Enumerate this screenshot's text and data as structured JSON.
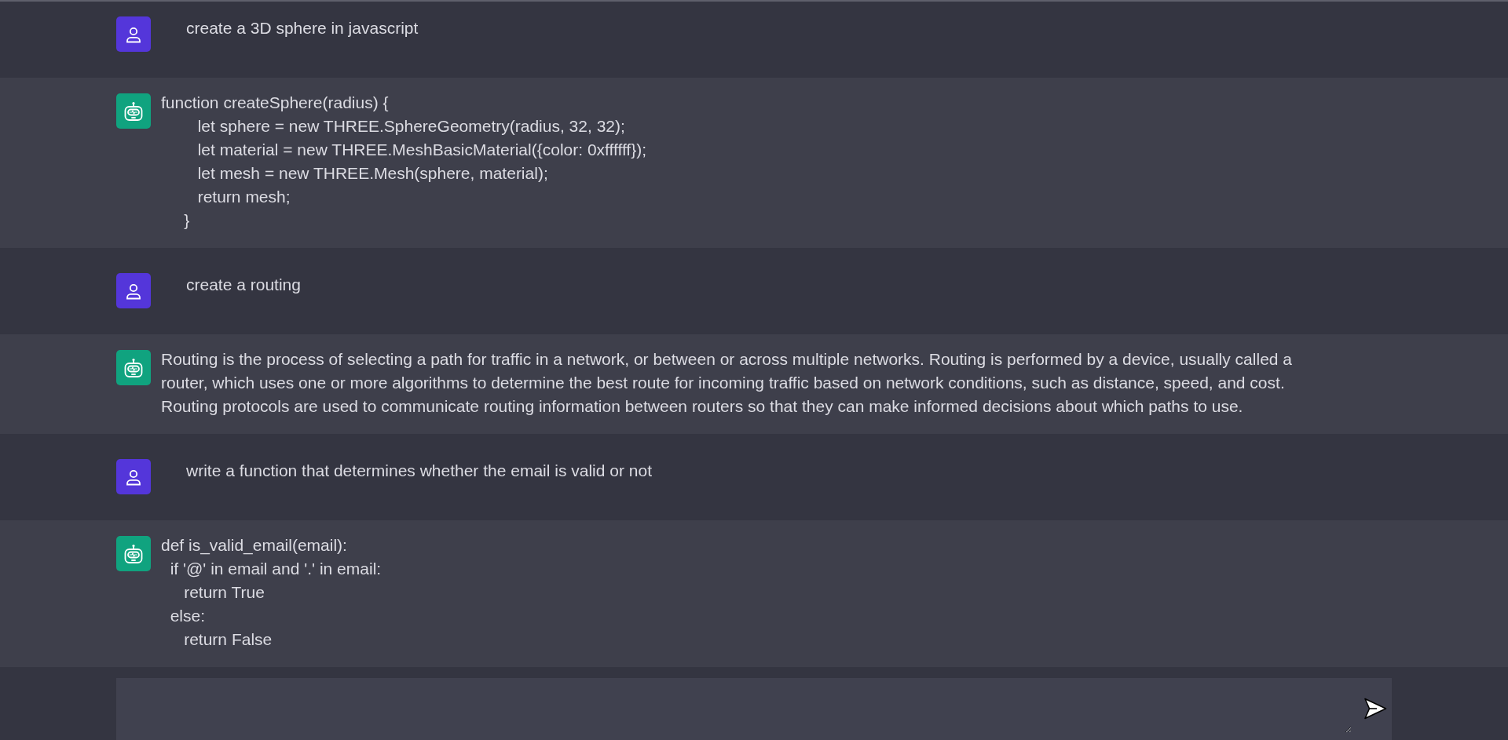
{
  "messages": [
    {
      "kind": "user",
      "text": "create a 3D sphere in javascript"
    },
    {
      "kind": "bot",
      "text": "function createSphere(radius) {\n        let sphere = new THREE.SphereGeometry(radius, 32, 32);\n        let material = new THREE.MeshBasicMaterial({color: 0xffffff});\n        let mesh = new THREE.Mesh(sphere, material);\n        return mesh;\n     }"
    },
    {
      "kind": "user",
      "text": "create a routing"
    },
    {
      "kind": "bot",
      "text": "Routing is the process of selecting a path for traffic in a network, or between or across multiple networks. Routing is performed by a device, usually called a router, which uses one or more algorithms to determine the best route for incoming traffic based on network conditions, such as distance, speed, and cost.\nRouting protocols are used to communicate routing information between routers so that they can make informed decisions about which paths to use."
    },
    {
      "kind": "user",
      "text": "write a function that determines whether the email is valid or not"
    },
    {
      "kind": "bot",
      "text": "def is_valid_email(email):\n  if '@' in email and '.' in email:\n     return True\n  else:\n     return False"
    }
  ]
}
